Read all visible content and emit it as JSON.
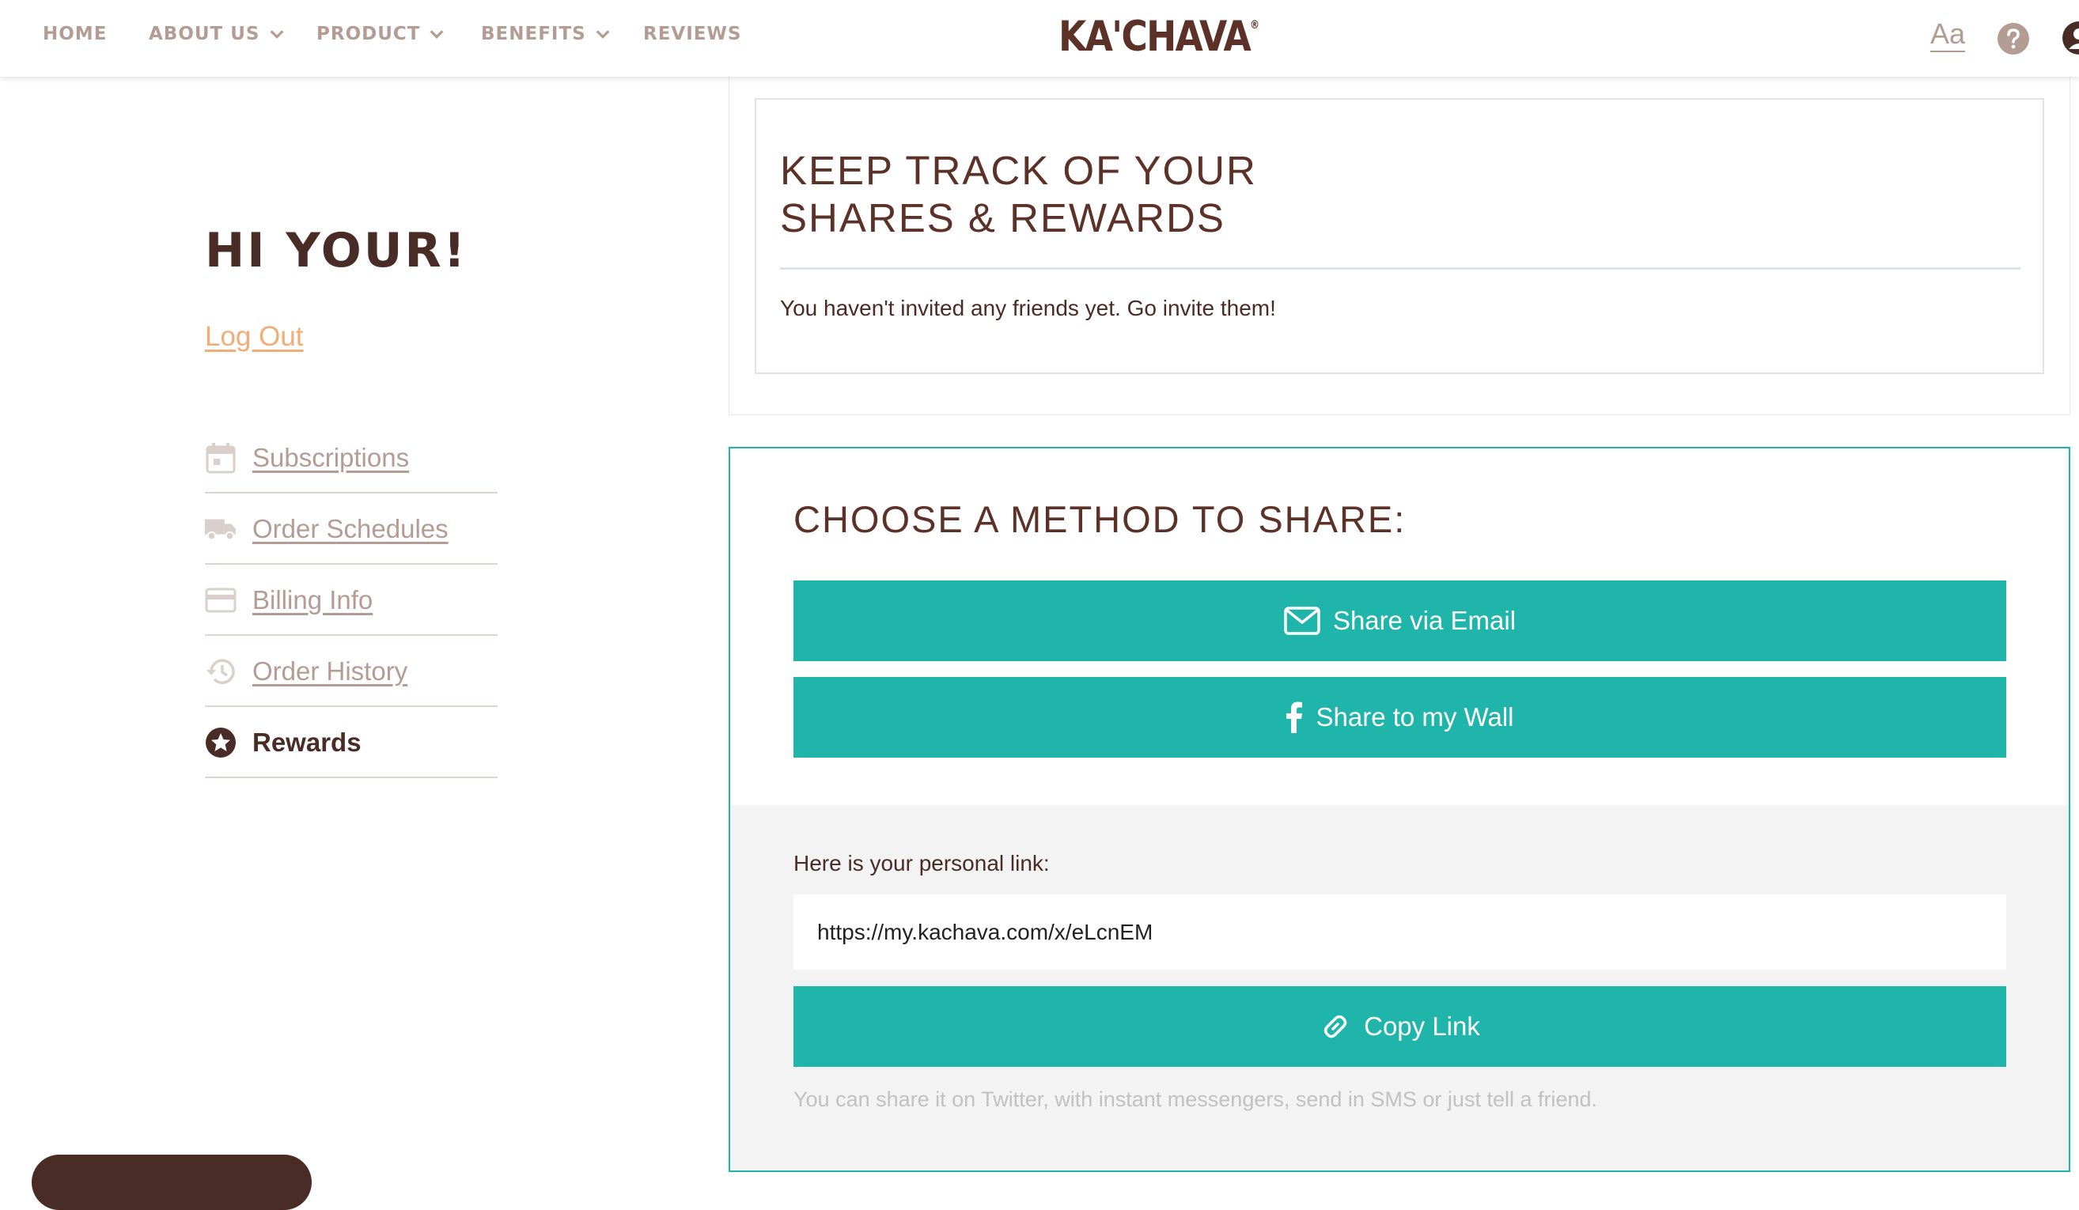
{
  "nav": {
    "items": [
      {
        "label": "HOME",
        "dropdown": false
      },
      {
        "label": "ABOUT US",
        "dropdown": true
      },
      {
        "label": "PRODUCT",
        "dropdown": true
      },
      {
        "label": "BENEFITS",
        "dropdown": true
      },
      {
        "label": "REVIEWS",
        "dropdown": false
      }
    ],
    "logo_text": "KA'CHAVA",
    "logo_mark": "®",
    "font_size_icon_text": "Aa",
    "help_icon": "question-circle-icon",
    "account_icon": "user-icon"
  },
  "sidebar": {
    "greeting": "HI YOUR!",
    "logout_label": "Log Out",
    "items": [
      {
        "label": "Subscriptions",
        "icon": "calendar-icon",
        "active": false
      },
      {
        "label": "Order Schedules",
        "icon": "truck-icon",
        "active": false
      },
      {
        "label": "Billing Info",
        "icon": "credit-card-icon",
        "active": false
      },
      {
        "label": "Order History",
        "icon": "history-icon",
        "active": false
      },
      {
        "label": "Rewards",
        "icon": "star-circle-icon",
        "active": true
      }
    ]
  },
  "track": {
    "title_line1": "KEEP TRACK OF YOUR",
    "title_line2": "SHARES & REWARDS",
    "message": "You haven't invited any friends yet. Go invite them!"
  },
  "share": {
    "title": "CHOOSE A METHOD TO SHARE:",
    "email_button": "Share via Email",
    "wall_button": "Share to my Wall",
    "link_label": "Here is your personal link:",
    "link_value": "https://my.kachava.com/x/eLcnEM",
    "copy_button": "Copy Link",
    "hint": "You can share it on Twitter, with instant messengers, send in SMS or just tell a friend."
  },
  "colors": {
    "brand_brown": "#4a2c26",
    "accent_teal": "#20b5aa",
    "logout_orange": "#f2ad76",
    "muted": "#b39c93"
  }
}
